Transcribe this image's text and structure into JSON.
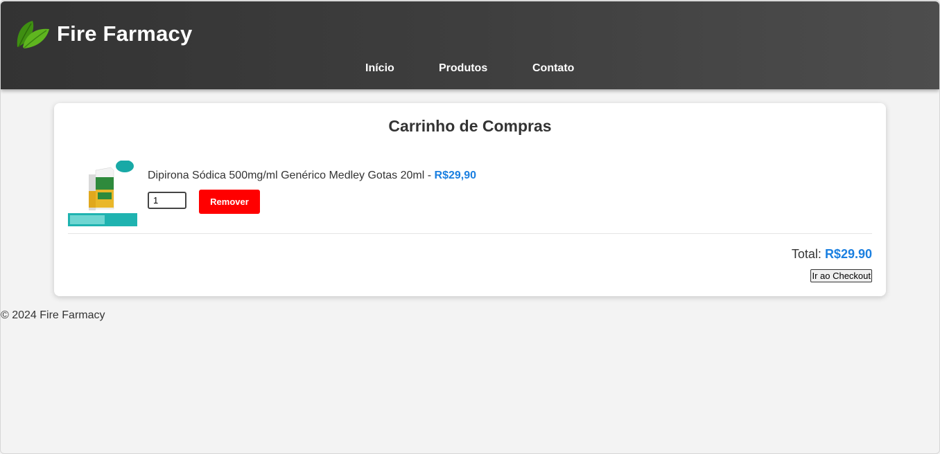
{
  "header": {
    "brand": "Fire Farmacy",
    "logo_icon": "leaf-icon",
    "nav": [
      "Início",
      "Produtos",
      "Contato"
    ]
  },
  "cart": {
    "title": "Carrinho de Compras",
    "items": [
      {
        "name": "Dipirona Sódica 500mg/ml Genérico Medley Gotas 20ml",
        "separator": " - ",
        "price": "R$29,90",
        "quantity": "1",
        "remove_label": "Remover",
        "image_icon": "medicine-box-image"
      }
    ],
    "total_label": "Total:",
    "total_value": "R$29.90",
    "checkout_label": "Ir ao Checkout"
  },
  "footer": {
    "text": "© 2024 Fire Farmacy"
  },
  "colors": {
    "header_bg": "#3a3a3a",
    "price": "#1a7fe0",
    "remove_button": "#ff0000",
    "leaf": "#4caf1a"
  }
}
